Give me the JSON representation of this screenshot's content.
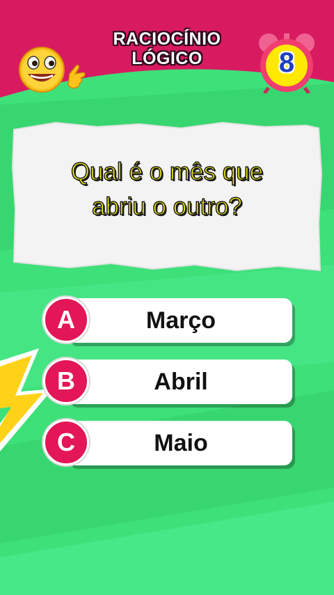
{
  "header": {
    "title_line1": "RACIOCÍNIO",
    "title_line2": "LÓGICO"
  },
  "timer": {
    "value": "8"
  },
  "question": {
    "line1": "Qual é o mês que",
    "line2": "abriu o outro?"
  },
  "options": [
    {
      "letter": "A",
      "label": "Março"
    },
    {
      "letter": "B",
      "label": "Abril"
    },
    {
      "letter": "C",
      "label": "Maio"
    }
  ],
  "colors": {
    "header_bg": "#d81b60",
    "background": "#3ee07a",
    "accent_circle": "#e31657",
    "question_text": "#f6f20e"
  },
  "icons": [
    "smiley-emoji-icon",
    "alarm-clock-icon",
    "lightning-bolt-icon"
  ]
}
